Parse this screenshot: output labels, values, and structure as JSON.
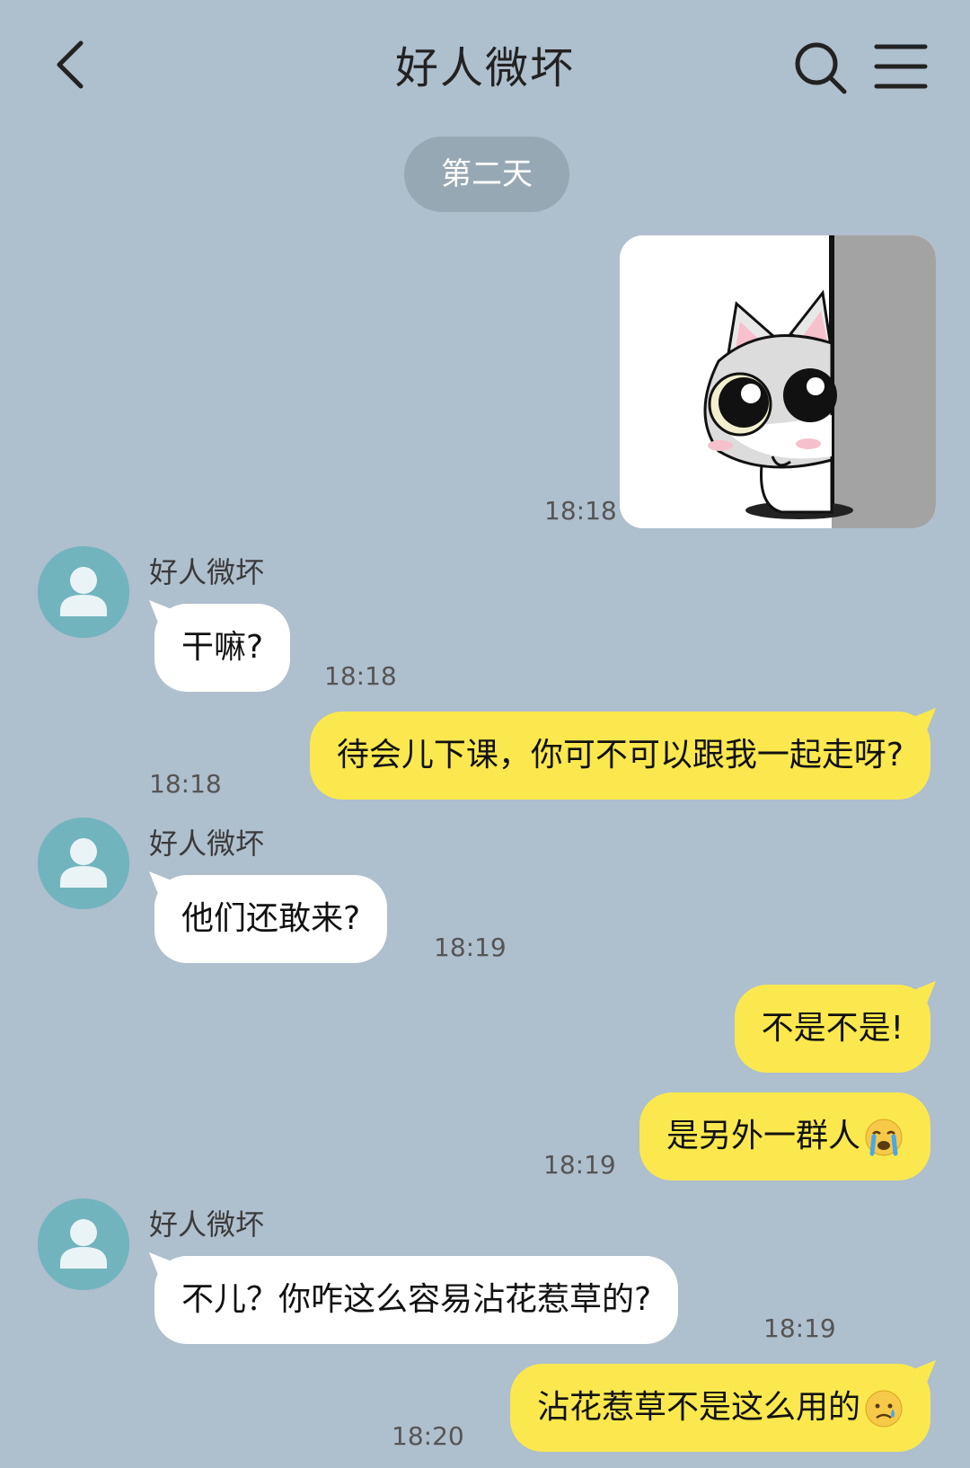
{
  "header": {
    "title": "好人微坏",
    "back_icon": "chevron-left-icon",
    "search_icon": "search-icon",
    "menu_icon": "menu-icon"
  },
  "date_separator": "第二天",
  "colors": {
    "background": "#aebfce",
    "own_bubble": "#fbe84e",
    "other_bubble": "#ffffff",
    "avatar": "#72b4bd"
  },
  "messages": [
    {
      "side": "right",
      "type": "sticker",
      "sticker": "cat-peeking-sticker",
      "time": "18:18"
    },
    {
      "side": "left",
      "name": "好人微坏",
      "text": "干嘛?",
      "time": "18:18"
    },
    {
      "side": "right",
      "text": "待会儿下课，你可不可以跟我一起走呀?",
      "time": "18:18"
    },
    {
      "side": "left",
      "name": "好人微坏",
      "text": "他们还敢来?",
      "time": "18:19"
    },
    {
      "side": "right",
      "text": "不是不是!",
      "time": ""
    },
    {
      "side": "right",
      "text": "是另外一群人",
      "emoji": "crying-emoji",
      "time": "18:19"
    },
    {
      "side": "left",
      "name": "好人微坏",
      "text": "不儿？你咋这么容易沾花惹草的?",
      "time": "18:19"
    },
    {
      "side": "right",
      "text": "沾花惹草不是这么用的",
      "emoji": "sad-tear-emoji",
      "time": "18:20"
    }
  ]
}
